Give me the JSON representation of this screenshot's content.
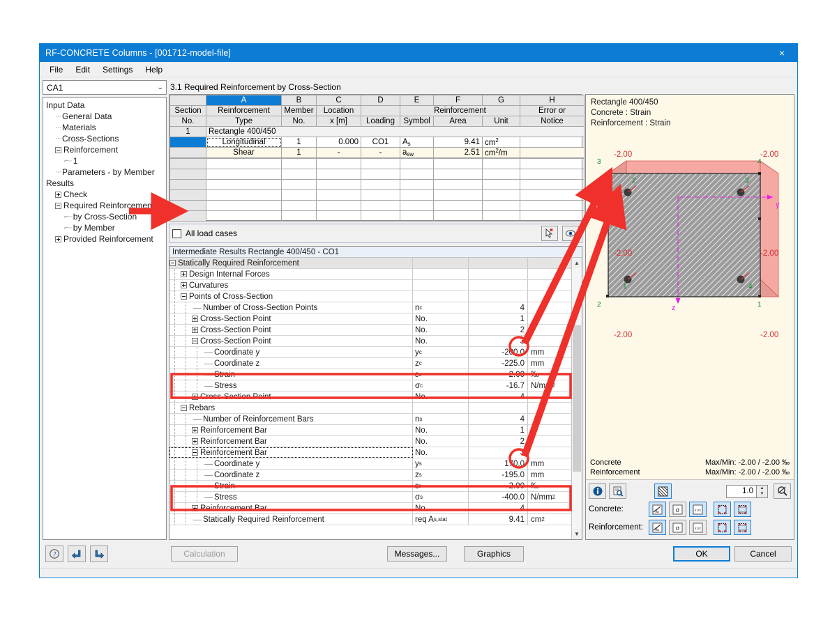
{
  "window": {
    "title": "RF-CONCRETE Columns - [001712-model-file]",
    "close_icon": "×",
    "menu": [
      "File",
      "Edit",
      "Settings",
      "Help"
    ]
  },
  "sidebar": {
    "combo_value": "CA1",
    "chevron": "⌄",
    "items": [
      {
        "label": "Input Data",
        "level": 0,
        "toggle": "none"
      },
      {
        "label": "General Data",
        "level": 1,
        "toggle": "none"
      },
      {
        "label": "Materials",
        "level": 1,
        "toggle": "none"
      },
      {
        "label": "Cross-Sections",
        "level": 1,
        "toggle": "none"
      },
      {
        "label": "Reinforcement",
        "level": 1,
        "toggle": "minus"
      },
      {
        "label": "1",
        "level": 2,
        "toggle": "none"
      },
      {
        "label": "Parameters - by Member",
        "level": 1,
        "toggle": "none"
      },
      {
        "label": "Results",
        "level": 0,
        "toggle": "none"
      },
      {
        "label": "Check",
        "level": 1,
        "toggle": "plus"
      },
      {
        "label": "Required Reinforcement",
        "level": 1,
        "toggle": "minus"
      },
      {
        "label": "by Cross-Section",
        "level": 2,
        "toggle": "none"
      },
      {
        "label": "by Member",
        "level": 2,
        "toggle": "none"
      },
      {
        "label": "Provided Reinforcement",
        "level": 1,
        "toggle": "plus"
      }
    ]
  },
  "main": {
    "panel_title": "3.1 Required Reinforcement by Cross-Section",
    "grid": {
      "column_letters": [
        "",
        "A",
        "B",
        "C",
        "D",
        "E",
        "F",
        "G",
        "H"
      ],
      "selected_column": "A",
      "headers_top": [
        "Section",
        "Reinforcement",
        "Member",
        "Location",
        "",
        "Symbol",
        "Reinforcement",
        "",
        "Error or"
      ],
      "headers": [
        {
          "l1": "Section",
          "l2": "No."
        },
        {
          "l1": "Reinforcement",
          "l2": "Type"
        },
        {
          "l1": "Member",
          "l2": "No."
        },
        {
          "l1": "Location",
          "l2": "x [m]"
        },
        {
          "l1": "",
          "l2": "Loading"
        },
        {
          "l1": "",
          "l2": "Symbol"
        },
        {
          "l1": "",
          "l2": "Area"
        },
        {
          "l1": "",
          "l2": "Unit"
        },
        {
          "l1": "Error or",
          "l2": "Notice"
        }
      ],
      "group_header_reinforcement": "Reinforcement",
      "section_row": {
        "no": "1",
        "label": "Rectangle 400/450"
      },
      "rows": [
        {
          "no": "",
          "type": "Longitudinal",
          "member": "1",
          "location": "0.000",
          "loading": "CO1",
          "symbol": "As",
          "symbol_sub": "s",
          "symbol_base": "A",
          "area": "9.41",
          "unit": "cm²",
          "unit_base": "cm",
          "unit_sup": "2",
          "error": ""
        },
        {
          "no": "",
          "type": "Shear",
          "member": "1",
          "location": "-",
          "loading": "-",
          "symbol": "asw",
          "symbol_base": "a",
          "symbol_sub": "sw",
          "area": "2.51",
          "unit": "cm²/m",
          "unit_base": "cm",
          "unit_sup": "2",
          "unit_tail": "/m",
          "error": ""
        }
      ]
    },
    "all_load_cases_label": "All load cases",
    "all_load_cases_checked": false,
    "pick_icon": "pick-cursor-icon",
    "view_icon": "eye-icon"
  },
  "intermediate": {
    "title": "Intermediate Results Rectangle 400/450 - CO1",
    "rows": [
      {
        "label": "Statically Required Reinforcement",
        "indent": 0,
        "toggle": "minus",
        "symbol": "",
        "value": "",
        "unit": "",
        "header": true
      },
      {
        "label": "Design Internal Forces",
        "indent": 1,
        "toggle": "plus",
        "symbol": "",
        "value": "",
        "unit": ""
      },
      {
        "label": "Curvatures",
        "indent": 1,
        "toggle": "plus",
        "symbol": "",
        "value": "",
        "unit": ""
      },
      {
        "label": "Points of Cross-Section",
        "indent": 1,
        "toggle": "minus",
        "symbol": "",
        "value": "",
        "unit": ""
      },
      {
        "label": "Number of Cross-Section Points",
        "indent": 2,
        "toggle": "leaf",
        "symbol": "nc",
        "sym_base": "n",
        "sym_sub": "c",
        "value": "4",
        "unit": ""
      },
      {
        "label": "Cross-Section Point",
        "indent": 2,
        "toggle": "plus",
        "symbol": "No.",
        "value": "1",
        "unit": ""
      },
      {
        "label": "Cross-Section Point",
        "indent": 2,
        "toggle": "plus",
        "symbol": "No.",
        "value": "2",
        "unit": ""
      },
      {
        "label": "Cross-Section Point",
        "indent": 2,
        "toggle": "minus",
        "symbol": "No.",
        "value": "3",
        "unit": "",
        "circled": true
      },
      {
        "label": "Coordinate y",
        "indent": 3,
        "toggle": "leaf",
        "symbol": "yc",
        "sym_base": "y",
        "sym_sub": "c",
        "value": "-200.0",
        "unit": "mm"
      },
      {
        "label": "Coordinate z",
        "indent": 3,
        "toggle": "leaf",
        "symbol": "zc",
        "sym_base": "z",
        "sym_sub": "c",
        "value": "-225.0",
        "unit": "mm"
      },
      {
        "label": "Strain",
        "indent": 3,
        "toggle": "leaf",
        "symbol": "εc",
        "sym_base": "ε",
        "sym_sub": "c",
        "value": "-2.00",
        "unit": "‰",
        "highlight": true
      },
      {
        "label": "Stress",
        "indent": 3,
        "toggle": "leaf",
        "symbol": "σc",
        "sym_base": "σ",
        "sym_sub": "c",
        "value": "-16.7",
        "unit": "N/mm²",
        "unit_base": "N/mm",
        "unit_sup": "2",
        "highlight": true
      },
      {
        "label": "Cross-Section Point",
        "indent": 2,
        "toggle": "plus",
        "symbol": "No.",
        "value": "4",
        "unit": ""
      },
      {
        "label": "Rebars",
        "indent": 1,
        "toggle": "minus",
        "symbol": "",
        "value": "",
        "unit": ""
      },
      {
        "label": "Number of Reinforcement Bars",
        "indent": 2,
        "toggle": "leaf",
        "symbol": "ns",
        "sym_base": "n",
        "sym_sub": "s",
        "value": "4",
        "unit": ""
      },
      {
        "label": "Reinforcement Bar",
        "indent": 2,
        "toggle": "plus",
        "symbol": "No.",
        "value": "1",
        "unit": ""
      },
      {
        "label": "Reinforcement Bar",
        "indent": 2,
        "toggle": "plus",
        "symbol": "No.",
        "value": "2",
        "unit": ""
      },
      {
        "label": "Reinforcement Bar",
        "indent": 2,
        "toggle": "minus",
        "symbol": "No.",
        "value": "3",
        "unit": "",
        "selected": true,
        "circled": true
      },
      {
        "label": "Coordinate y",
        "indent": 3,
        "toggle": "leaf",
        "symbol": "ys",
        "sym_base": "y",
        "sym_sub": "s",
        "value": "170.0",
        "unit": "mm"
      },
      {
        "label": "Coordinate z",
        "indent": 3,
        "toggle": "leaf",
        "symbol": "zs",
        "sym_base": "z",
        "sym_sub": "s",
        "value": "-195.0",
        "unit": "mm"
      },
      {
        "label": "Strain",
        "indent": 3,
        "toggle": "leaf",
        "symbol": "εs",
        "sym_base": "ε",
        "sym_sub": "s",
        "value": "-2.00",
        "unit": "‰",
        "highlight": true
      },
      {
        "label": "Stress",
        "indent": 3,
        "toggle": "leaf",
        "symbol": "σs",
        "sym_base": "σ",
        "sym_sub": "s",
        "value": "-400.0",
        "unit": "N/mm²",
        "unit_base": "N/mm",
        "unit_sup": "2",
        "highlight": true
      },
      {
        "label": "Reinforcement Bar",
        "indent": 2,
        "toggle": "plus",
        "symbol": "No.",
        "value": "4",
        "unit": ""
      },
      {
        "label": "Statically Required Reinforcement",
        "indent": 2,
        "toggle": "leaf",
        "symbol": "req As,stat",
        "sym_base": "req A",
        "sym_sub": "s,stat",
        "value": "9.41",
        "unit": "cm²",
        "unit_base": "cm",
        "unit_sup": "2"
      }
    ]
  },
  "graphics": {
    "caption_lines": [
      "Rectangle 400/450",
      "Concrete : Strain",
      "Reinforcement : Strain"
    ],
    "strain_labels": [
      "-2.00",
      "-2.00",
      "-2.00",
      "-2.00",
      "-2.00",
      "-2.00"
    ],
    "corner_numbers_outer": [
      "3",
      "4",
      "2",
      "1"
    ],
    "corner_numbers_inner": [
      "2",
      "3",
      "1",
      "4"
    ],
    "axis_y_label": "y",
    "axis_z_label": "z",
    "info": [
      {
        "name": "Concrete",
        "value": "Max/Min: -2.00 / -2.00 ‰"
      },
      {
        "name": "Reinforcement",
        "value": "Max/Min: -2.00 / -2.00 ‰"
      }
    ],
    "zoom_value": "1.0",
    "toolbar": {
      "info_icon": "info-icon",
      "print_icon": "print-preview-icon",
      "hatch_icon": "hatch-fill-icon",
      "zoom_reset_icon": "zoom-reset-icon",
      "spin_up": "▲",
      "spin_down": "▼"
    },
    "concrete_label": "Concrete:",
    "reinforcement_label": "Reinforcement:",
    "concrete_buttons": [
      "concrete-strain-icon",
      "concrete-stress-icon",
      "concrete-values-icon",
      "concrete-section-icon",
      "concrete-diagram-icon"
    ],
    "reinforcement_buttons": [
      "rebar-strain-icon",
      "rebar-stress-icon",
      "rebar-values-icon",
      "rebar-points-icon",
      "rebar-diagram-icon"
    ],
    "concrete_active": [
      true,
      false,
      true,
      true,
      true
    ],
    "reinforcement_active": [
      true,
      false,
      false,
      true,
      true
    ]
  },
  "footer": {
    "help_icon": "help-icon",
    "prev_icon": "previous-icon",
    "next_icon": "next-icon",
    "calculation_label": "Calculation",
    "messages_label": "Messages...",
    "graphics_label": "Graphics",
    "ok_label": "OK",
    "cancel_label": "Cancel"
  },
  "colors": {
    "title_bar": "#0c7cd5",
    "accent": "#0c7cd5",
    "annotation_red": "#f0302a",
    "beige_panel": "#fdf8e8",
    "concrete_fill": "#9a9a9a",
    "strain_overlay": "#f5a6a0",
    "axis_magenta": "#e81ee8",
    "corner_green": "#0a8a2a"
  }
}
